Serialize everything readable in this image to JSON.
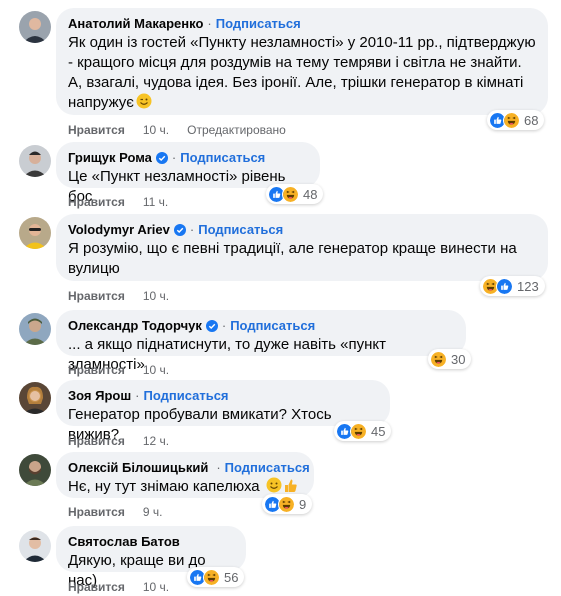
{
  "follow_label": "Подписаться",
  "like_label": "Нравится",
  "colors": {
    "link": "#216fdb",
    "bubble": "#f0f2f5",
    "muted": "#65676b",
    "like_blue": "#1877f2",
    "haha_yellow": "#f7b125"
  },
  "comments": [
    {
      "author": "Анатолий Макаренко",
      "verified": false,
      "text": "Як один із гостей «Пункту незламності» у 2010-11 рр., підтверджую - кращого місця для роздумів на тему темряви і світла не знайти. А, взагалі, чудова ідея. Без іронії. Але, трішки генератор в кімнаті напружує",
      "inline_emoji": "wink-smile-emoji",
      "reactions": [
        "like-reaction",
        "haha-reaction"
      ],
      "reaction_count": "68",
      "time": "10 ч.",
      "edited": "Отредактировано"
    },
    {
      "author": "Грищук Рома",
      "verified": true,
      "text": "Це «Пункт незламності» рівень бос",
      "reactions": [
        "like-reaction",
        "haha-reaction"
      ],
      "reaction_count": "48",
      "time": "11 ч."
    },
    {
      "author": "Volodymyr Ariev",
      "verified": true,
      "text": "Я розумію, що є певні традиції, але генератор краще винести на вулицю",
      "reactions": [
        "haha-reaction",
        "like-reaction"
      ],
      "reaction_count": "123",
      "time": "10 ч."
    },
    {
      "author": "Олександр Тодорчук",
      "verified": true,
      "text": "... а якщо піднатиснути, то дуже навіть «пункт зламності»",
      "reactions": [
        "haha-reaction"
      ],
      "reaction_count": "30",
      "time": "10 ч."
    },
    {
      "author": "Зоя Ярош",
      "verified": false,
      "text": "Генератор пробували вмикати? Хтось вижив?",
      "reactions": [
        "like-reaction",
        "haha-reaction"
      ],
      "reaction_count": "45",
      "time": "12 ч."
    },
    {
      "author": "Олексій Білошицький",
      "verified": true,
      "text": "Нє, ну тут знімаю капелюха",
      "inline_emoji": "smile-thumbs-up-emoji",
      "reactions": [
        "like-reaction",
        "haha-reaction"
      ],
      "reaction_count": "9",
      "time": "9 ч."
    },
    {
      "author": "Святослав Батов",
      "verified": false,
      "text": "Дякую, краще ви до нас)",
      "reactions": [
        "like-reaction",
        "haha-reaction"
      ],
      "reaction_count": "56",
      "time": "10 ч."
    }
  ]
}
